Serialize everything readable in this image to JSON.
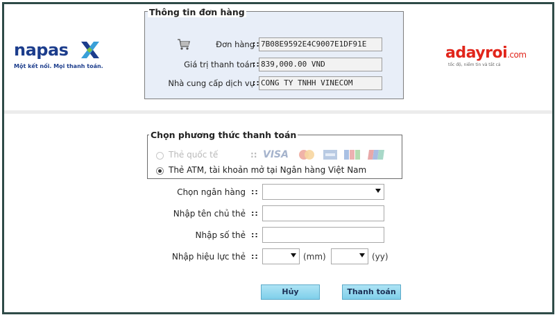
{
  "brand_left": {
    "name": "napas",
    "tagline": "Một kết nối. Mọi thanh toán."
  },
  "brand_right": {
    "name": "adayroi",
    "suffix": ".com",
    "tagline": "tốc độ, niềm tin và tất cả"
  },
  "order": {
    "legend": "Thông tin đơn hàng",
    "rows": [
      {
        "label": "Đơn hàng",
        "sep": "::",
        "value": "7B08E9592E4C9007E1DF91E"
      },
      {
        "label": "Giá trị thanh toán",
        "sep": "::",
        "value": "839,000.00 VND"
      },
      {
        "label": "Nhà cung cấp dịch vụ",
        "sep": "::",
        "value": "CONG TY TNHH VINECOM"
      }
    ]
  },
  "payment": {
    "legend": "Chọn phương thức thanh toán",
    "options": [
      {
        "label": "Thẻ quốc tế",
        "sep": "::",
        "selected": false,
        "disabled": true
      },
      {
        "label": "Thẻ ATM, tài khoản mở tại Ngân hàng Việt Nam",
        "selected": true,
        "disabled": false
      }
    ],
    "card_icons": [
      "visa-icon",
      "mastercard-icon",
      "amex-icon",
      "jcb-icon",
      "unionpay-icon"
    ],
    "visa_text": "VISA"
  },
  "form": {
    "bank_label": "Chọn ngân hàng",
    "holder_label": "Nhập tên chủ thẻ",
    "number_label": "Nhập số thẻ",
    "validity_label": "Nhập hiệu lực thẻ",
    "sep": "::",
    "month_unit": "(mm)",
    "year_unit": "(yy)"
  },
  "buttons": {
    "cancel": "Hủy",
    "pay": "Thanh toán"
  },
  "colors": {
    "napas_blue": "#1c3d8c",
    "aday_red": "#e1251b",
    "button": "#8fd6ee",
    "frame": "#2e4a47"
  }
}
